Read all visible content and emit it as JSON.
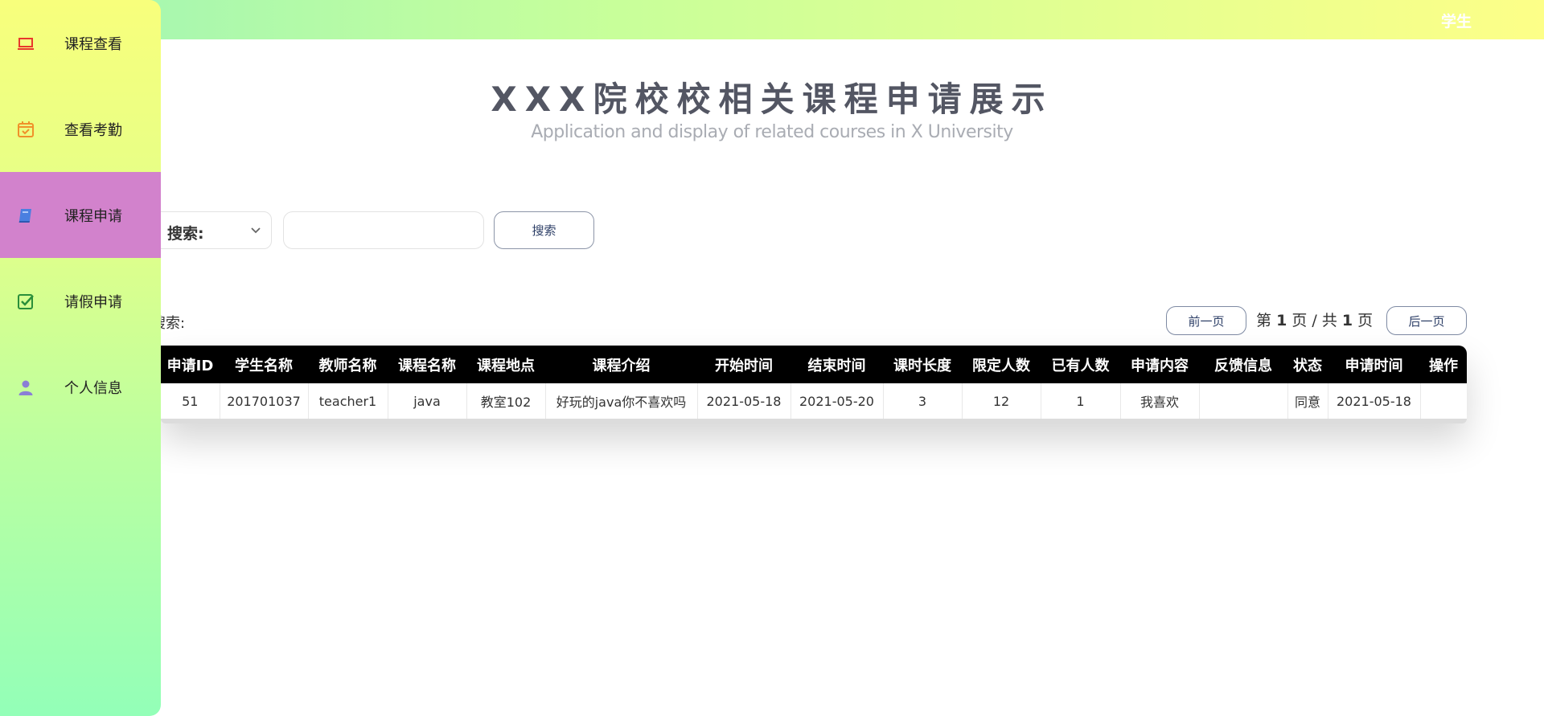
{
  "header": {
    "role": "学生"
  },
  "sidebar": {
    "items": [
      {
        "label": "课程查看",
        "icon": "laptop-icon",
        "active": false
      },
      {
        "label": "查看考勤",
        "icon": "calendar-check-icon",
        "active": false
      },
      {
        "label": "课程申请",
        "icon": "book-icon",
        "active": true
      },
      {
        "label": "请假申请",
        "icon": "checkbox-icon",
        "active": false
      },
      {
        "label": "个人信息",
        "icon": "user-icon",
        "active": false
      }
    ]
  },
  "page": {
    "title": "XXX院校校相关课程申请展示",
    "subtitle": "Application and display of related courses in X University"
  },
  "search": {
    "select_label": "搜索:",
    "input_value": "",
    "button_label": "搜索"
  },
  "results": {
    "label": "搜索:",
    "prev_label": "前一页",
    "next_label": "后一页",
    "page_prefix": "第",
    "page_current": "1",
    "page_mid": "页 / 共",
    "page_total": "1",
    "page_suffix": "页"
  },
  "table": {
    "columns": [
      "申请ID",
      "学生名称",
      "教师名称",
      "课程名称",
      "课程地点",
      "课程介绍",
      "开始时间",
      "结束时间",
      "课时长度",
      "限定人数",
      "已有人数",
      "申请内容",
      "反馈信息",
      "状态",
      "申请时间",
      "操作"
    ],
    "rows": [
      [
        "51",
        "201701037",
        "teacher1",
        "java",
        "教室102",
        "好玩的java你不喜欢吗",
        "2021-05-18",
        "2021-05-20",
        "3",
        "12",
        "1",
        "我喜欢",
        "",
        "同意",
        "2021-05-18",
        ""
      ]
    ]
  },
  "colors": {
    "sidebar_active": "#d282cc",
    "table_header": "#000000",
    "title": "#535663",
    "subtitle": "#a9acb3"
  }
}
